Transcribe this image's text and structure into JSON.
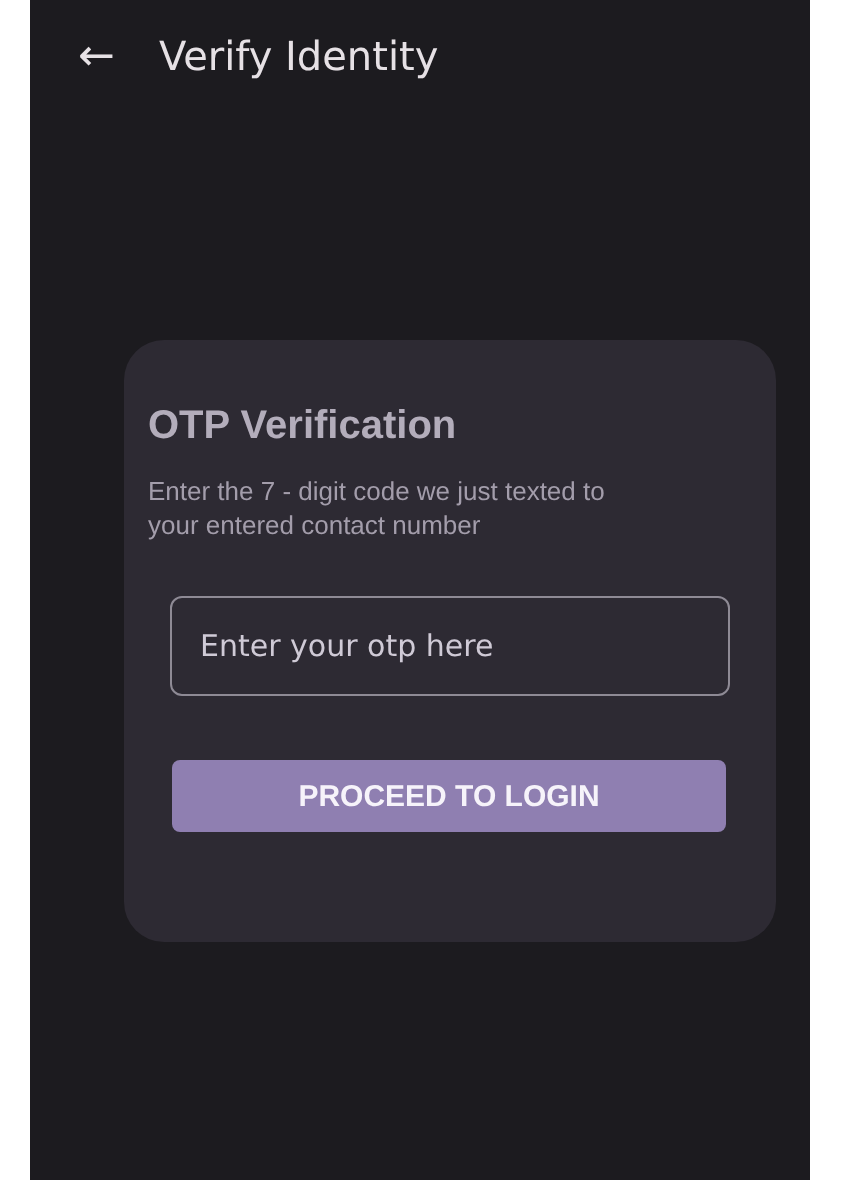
{
  "app_bar": {
    "back_icon": "←",
    "title": "Verify Identity"
  },
  "card": {
    "title": "OTP Verification",
    "description": "Enter the 7 - digit code we just texted to your entered contact number",
    "otp_field": {
      "placeholder": "Enter your otp here"
    },
    "button": "PROCEED TO LOGIN"
  }
}
